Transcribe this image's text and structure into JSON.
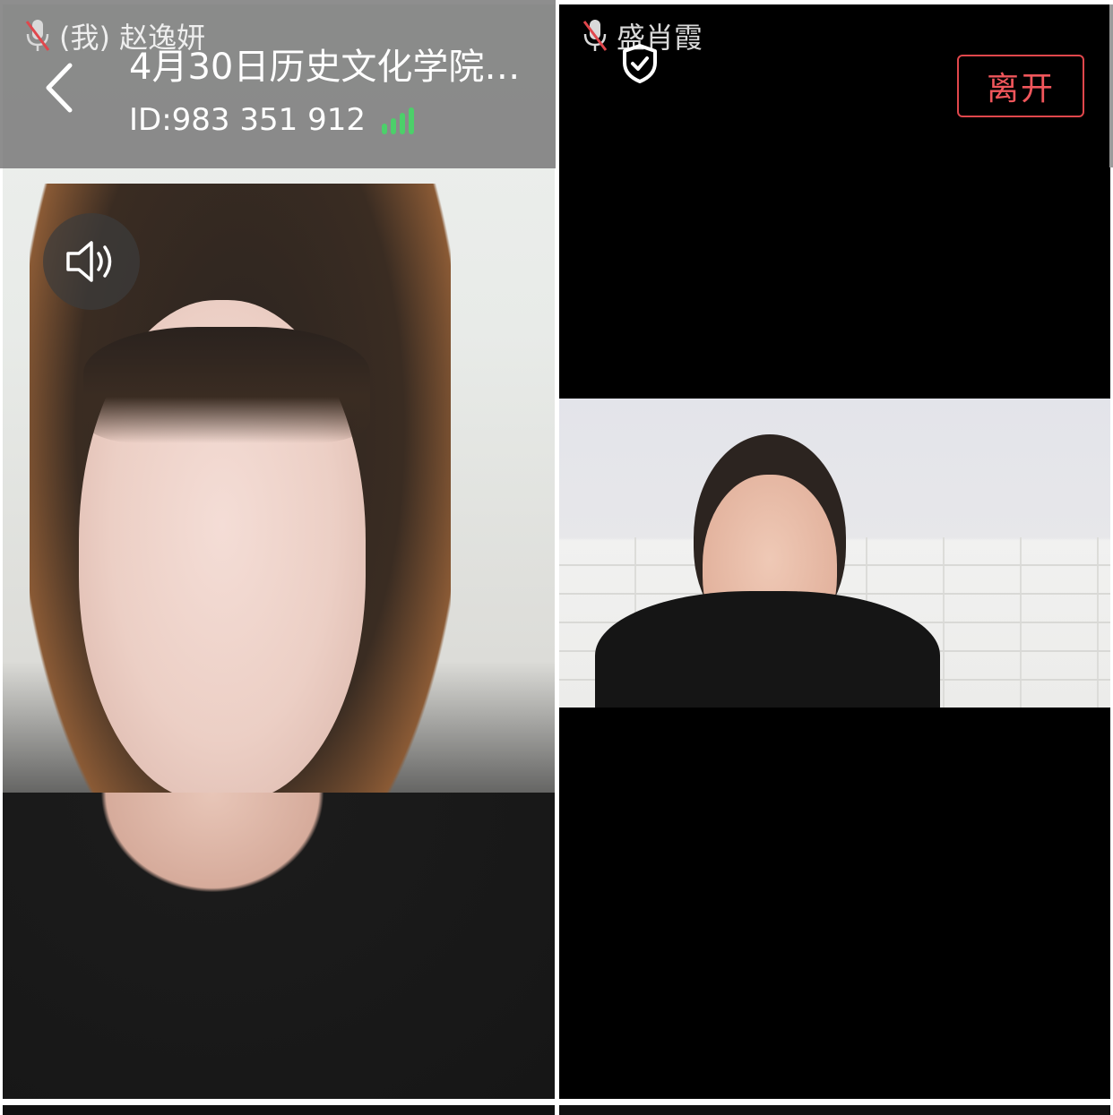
{
  "header": {
    "title": "4月30日历史文化学院…",
    "meeting_id": "ID:983 351 912",
    "leave_label": "离开"
  },
  "participants": [
    {
      "label": "(我) 赵逸妍",
      "mic": "muted"
    },
    {
      "label": "盛肖霞",
      "mic": "muted"
    }
  ],
  "colors": {
    "leave_accent": "#f0565b",
    "signal_good": "#4cd06a",
    "mic_muted_slash": "#e0474c"
  },
  "icons": {
    "back": "chevron-left-icon",
    "security": "shield-check-icon",
    "speaker": "speaker-volume-icon",
    "mic_muted": "mic-muted-icon",
    "signal": "signal-strength-icon"
  }
}
